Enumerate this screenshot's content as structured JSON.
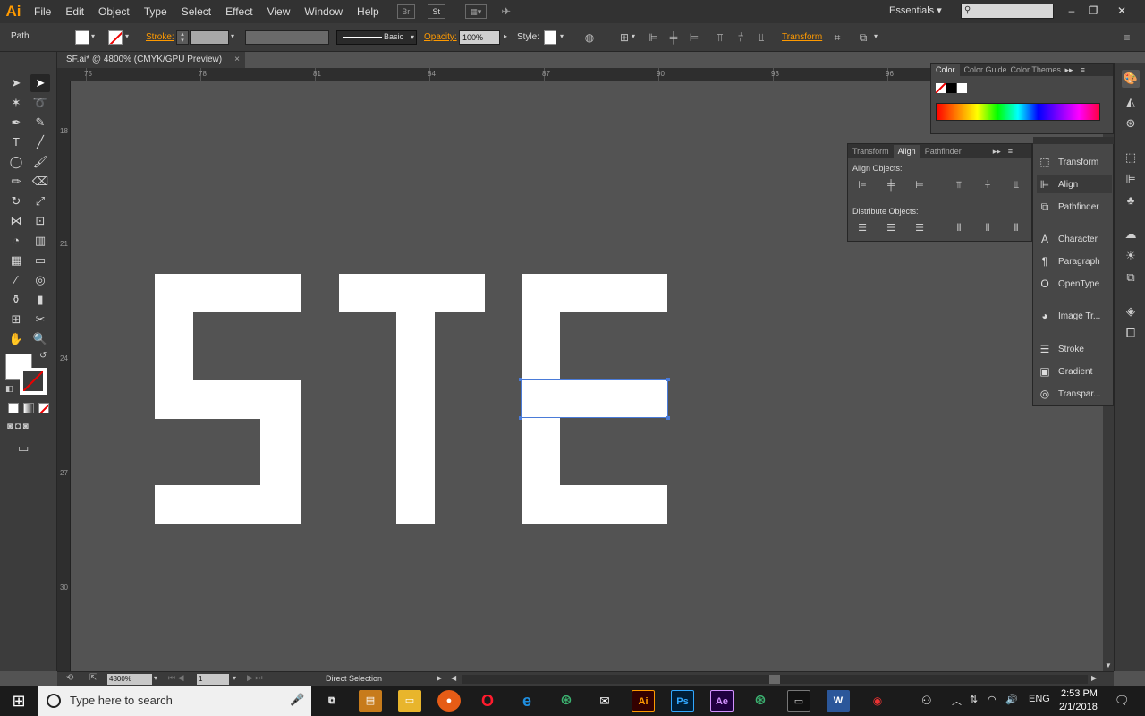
{
  "app": {
    "logo": "Ai"
  },
  "menu": [
    "File",
    "Edit",
    "Object",
    "Type",
    "Select",
    "Effect",
    "View",
    "Window",
    "Help"
  ],
  "menubar_icons": {
    "bridge": "Br",
    "stock": "St"
  },
  "workspace": "Essentials",
  "window_controls": {
    "minimize": "–",
    "restore": "❐",
    "close": "✕"
  },
  "controlbar": {
    "object_type": "Path",
    "stroke_label": "Stroke:",
    "stroke_style": "Basic",
    "opacity_label": "Opacity:",
    "opacity_value": "100%",
    "style_label": "Style:",
    "transform_label": "Transform"
  },
  "document": {
    "tab_title": "SF.ai* @ 4800% (CMYK/GPU Preview)",
    "close": "×"
  },
  "rulers": {
    "top": [
      "75",
      "78",
      "81",
      "84",
      "87",
      "90",
      "93",
      "96"
    ],
    "left": [
      "18",
      "21",
      "24",
      "27",
      "30"
    ]
  },
  "canvas": {
    "background": "#535353",
    "artwork_color": "#ffffff",
    "selection_color": "#4a7bd8"
  },
  "statusbar": {
    "zoom": "4800%",
    "page": "1",
    "status": "Direct Selection"
  },
  "color_panel": {
    "tabs": [
      "Color",
      "Color Guide",
      "Color Themes"
    ]
  },
  "align_panel": {
    "tabs": [
      "Transform",
      "Align",
      "Pathfinder"
    ],
    "align_objects": "Align Objects:",
    "distribute_objects": "Distribute Objects:"
  },
  "dock": {
    "items": [
      "Transform",
      "Align",
      "Pathfinder",
      "Character",
      "Paragraph",
      "OpenType",
      "Image Tr...",
      "Stroke",
      "Gradient",
      "Transpar..."
    ]
  },
  "taskbar": {
    "search_placeholder": "Type here to search",
    "apps": [
      "Ai",
      "Ps",
      "Ae",
      "W"
    ],
    "language": "ENG",
    "time": "2:53 PM",
    "date": "2/1/2018"
  }
}
